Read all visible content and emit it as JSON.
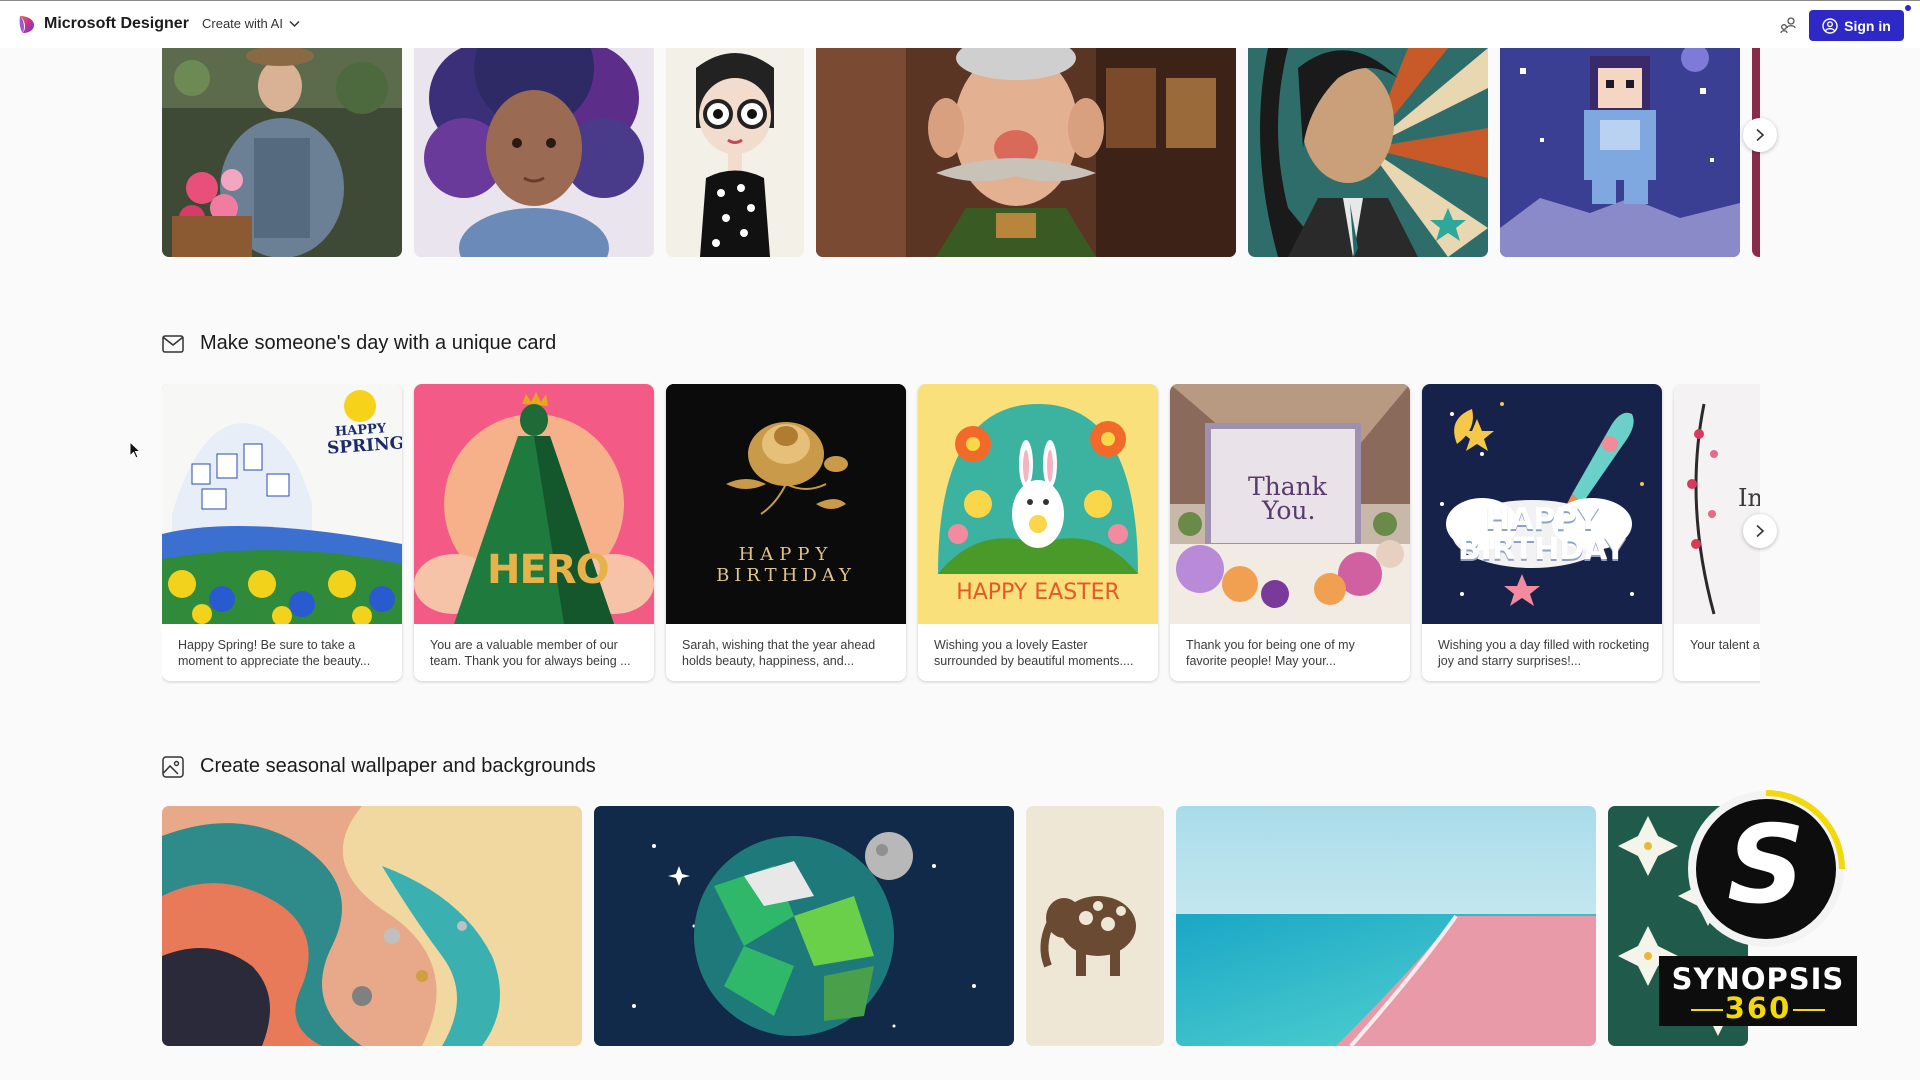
{
  "header": {
    "brand": "Microsoft Designer",
    "menu_label": "Create with AI",
    "signin_label": "Sign in"
  },
  "portraits_row": {
    "icons": [
      "portrait-gardener",
      "portrait-curly-child",
      "portrait-caricature-woman",
      "portrait-mustache-man",
      "portrait-popart-woman",
      "portrait-pixel-astronaut",
      "portrait-partial"
    ]
  },
  "cards_section": {
    "title": "Make someone's day with a unique card",
    "cards": [
      {
        "art_lines": [
          "HAPPY",
          "SPRING"
        ],
        "caption": "Happy Spring! Be sure to take a moment to appreciate the beauty..."
      },
      {
        "art_lines": [
          "HERO"
        ],
        "caption": "You are a valuable member of our team. Thank you for always being ..."
      },
      {
        "art_lines": [
          "HAPPY",
          "BIRTHDAY"
        ],
        "caption": "Sarah, wishing that the year ahead holds beauty, happiness, and..."
      },
      {
        "art_lines": [
          "HAPPY EASTER"
        ],
        "caption": "Wishing you a lovely Easter surrounded by beautiful moments...."
      },
      {
        "art_lines": [
          "Thank",
          "You."
        ],
        "caption": "Thank you for being one of my favorite people! May your..."
      },
      {
        "art_lines": [
          "HAPPY",
          "BIRTHDAY"
        ],
        "caption": "Wishing you a day filled with rocketing joy and starry surprises!..."
      },
      {
        "art_lines": [
          "In"
        ],
        "caption": "Your talent a magic in eve"
      }
    ]
  },
  "wallpaper_section": {
    "title": "Create seasonal wallpaper and backgrounds",
    "icons": [
      "wallpaper-abstract-waves",
      "wallpaper-lowpoly-earth",
      "wallpaper-floral-elephant",
      "wallpaper-pink-beach",
      "wallpaper-lilies"
    ]
  },
  "watermark": {
    "letter": "S",
    "line1": "SYNOPSIS",
    "line2": "360"
  }
}
